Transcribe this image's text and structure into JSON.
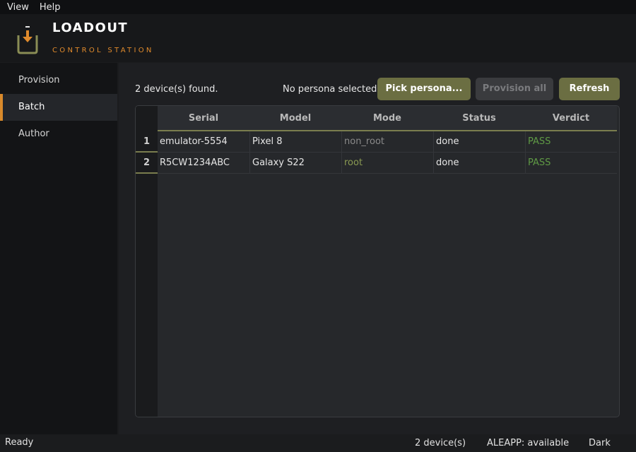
{
  "menu": {
    "items": [
      "View",
      "Help"
    ]
  },
  "header": {
    "title": "LOADOUT",
    "subtitle": "CONTROL STATION",
    "logo_icon": "download-tray-icon"
  },
  "sidebar": {
    "items": [
      {
        "label": "Provision",
        "active": false
      },
      {
        "label": "Batch",
        "active": true
      },
      {
        "label": "Author",
        "active": false
      }
    ]
  },
  "toolbar": {
    "found_text": "2 device(s) found.",
    "persona_text": "No persona selected",
    "pick_label": "Pick persona...",
    "provision_label": "Provision all",
    "refresh_label": "Refresh"
  },
  "table": {
    "columns": [
      "Serial",
      "Model",
      "Mode",
      "Status",
      "Verdict"
    ],
    "rows": [
      {
        "num": "1",
        "serial": "emulator-5554",
        "model": "Pixel 8",
        "mode": "non_root",
        "status": "done",
        "verdict": "PASS"
      },
      {
        "num": "2",
        "serial": "R5CW1234ABC",
        "model": "Galaxy S22",
        "mode": "root",
        "status": "done",
        "verdict": "PASS"
      }
    ]
  },
  "statusbar": {
    "left": "Ready",
    "devices": "2 device(s)",
    "aleapp": "ALEAPP: available",
    "theme": "Dark"
  },
  "colors": {
    "accent_orange": "#e08a2c",
    "accent_olive": "#6b6e42",
    "pass_green": "#5f9a45",
    "mode_non_root": "#8a8a8a",
    "mode_root": "#8a9a52"
  }
}
